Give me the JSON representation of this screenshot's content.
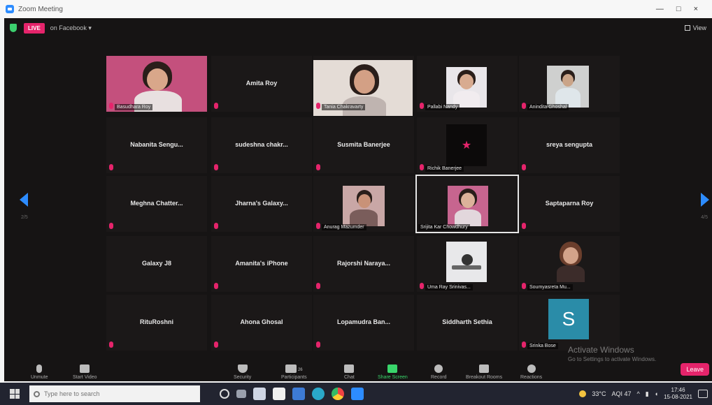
{
  "window": {
    "title": "Zoom Meeting",
    "controls": [
      "—",
      "□",
      "×"
    ]
  },
  "meeting": {
    "live_badge": "LIVE",
    "live_platform": "on Facebook ▾",
    "view_label": "View",
    "page_left": "2/5",
    "page_right": "4/5"
  },
  "participants": [
    {
      "name": "Basudhara Roy",
      "video": true
    },
    {
      "name": "Amita Roy",
      "video": false
    },
    {
      "name": "Tania Chakravarty",
      "video": true
    },
    {
      "name": "Pallabi Nandy",
      "video": true
    },
    {
      "name": "Anindita Ghoshal",
      "video": true
    },
    {
      "name": "Nabanita  Sengu...",
      "video": false
    },
    {
      "name": "sudeshna  chakr...",
      "video": false
    },
    {
      "name": "Susmita Banerjee",
      "video": false
    },
    {
      "name": "Richik Banerjee",
      "video": true
    },
    {
      "name": "sreya sengupta",
      "video": false
    },
    {
      "name": "Meghna  Chatter...",
      "video": false
    },
    {
      "name": "Jharna's  Galaxy...",
      "video": false
    },
    {
      "name": "Anurag Mazumder",
      "video": true
    },
    {
      "name": "Srijita Kar Chowdhury",
      "video": true
    },
    {
      "name": "Saptaparna Roy",
      "video": false
    },
    {
      "name": "Galaxy J8",
      "video": false
    },
    {
      "name": "Amanita's iPhone",
      "video": false
    },
    {
      "name": "Rajorshi  Naraya...",
      "video": false
    },
    {
      "name": "Uma Ray Srinivas...",
      "video": true
    },
    {
      "name": "Soumyasreta Mu...",
      "video": true
    },
    {
      "name": "RituRoshni",
      "video": false
    },
    {
      "name": "Ahona Ghosal",
      "video": false
    },
    {
      "name": "Lopamudra  Ban...",
      "video": false
    },
    {
      "name": "Siddharth Sethia",
      "video": false
    },
    {
      "name": "Srinka Bose",
      "video": true,
      "avatar_letter": "S"
    }
  ],
  "watermark": {
    "title": "Activate Windows",
    "subtitle": "Go to Settings to activate Windows."
  },
  "toolbar": {
    "unmute": "Unmute",
    "start_video": "Start Video",
    "security": "Security",
    "participants": "Participants",
    "participant_count": "26",
    "chat": "Chat",
    "share_screen": "Share Screen",
    "record": "Record",
    "breakout_rooms": "Breakout Rooms",
    "reactions": "Reactions",
    "leave": "Leave"
  },
  "taskbar": {
    "search_placeholder": "Type here to search",
    "weather": "33°C",
    "aqi": "AQI 47",
    "time": "17:46",
    "date": "15-08-2021"
  },
  "colors": {
    "accent_pink": "#e5246b",
    "zoom_blue": "#2d8cff",
    "avatar_teal": "#2a8ca8"
  }
}
